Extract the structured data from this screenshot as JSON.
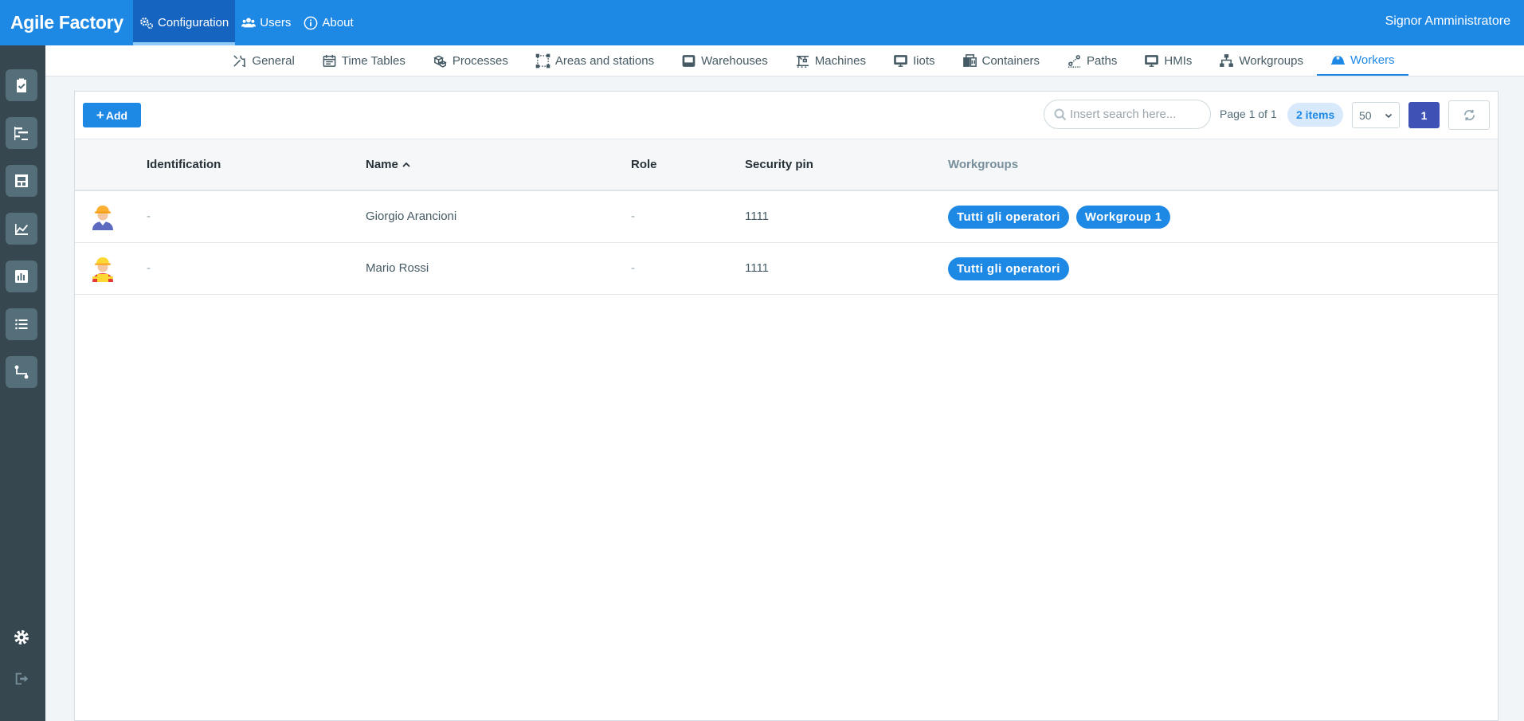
{
  "app": {
    "title": "Agile Factory",
    "user": "Signor Amministratore"
  },
  "topnav": [
    {
      "label": "Configuration",
      "icon": "cogs-icon"
    },
    {
      "label": "Users",
      "icon": "users-icon"
    },
    {
      "label": "About",
      "icon": "info-icon"
    }
  ],
  "subnav": [
    {
      "label": "General",
      "icon": "tools-icon"
    },
    {
      "label": "Time Tables",
      "icon": "calendar-icon"
    },
    {
      "label": "Processes",
      "icon": "cubes-icon"
    },
    {
      "label": "Areas and stations",
      "icon": "area-icon"
    },
    {
      "label": "Warehouses",
      "icon": "inbox-icon"
    },
    {
      "label": "Machines",
      "icon": "crane-icon"
    },
    {
      "label": "Iiots",
      "icon": "monitor-icon"
    },
    {
      "label": "Containers",
      "icon": "container-icon"
    },
    {
      "label": "Paths",
      "icon": "path-icon"
    },
    {
      "label": "HMIs",
      "icon": "monitor-icon"
    },
    {
      "label": "Workgroups",
      "icon": "sitemap-icon"
    },
    {
      "label": "Workers",
      "icon": "helmet-icon"
    }
  ],
  "toolbar": {
    "add_label": "Add",
    "search_placeholder": "Insert search here...",
    "page_info": "Page 1 of 1",
    "items_count": "2 items",
    "per_page": "50",
    "current_page": "1"
  },
  "table": {
    "columns": [
      "Identification",
      "Name",
      "Role",
      "Security pin",
      "Workgroups"
    ],
    "rows": [
      {
        "identification": "-",
        "name": "Giorgio Arancioni",
        "role": "-",
        "pin": "1111",
        "workgroups": [
          "Tutti gli operatori",
          "Workgroup 1"
        ]
      },
      {
        "identification": "-",
        "name": "Mario Rossi",
        "role": "-",
        "pin": "1111",
        "workgroups": [
          "Tutti gli operatori"
        ]
      }
    ]
  },
  "colors": {
    "primary": "#1e88e5",
    "topbar_active": "#1565c0",
    "sidebar": "#37474f",
    "page_button": "#3f51b5"
  }
}
